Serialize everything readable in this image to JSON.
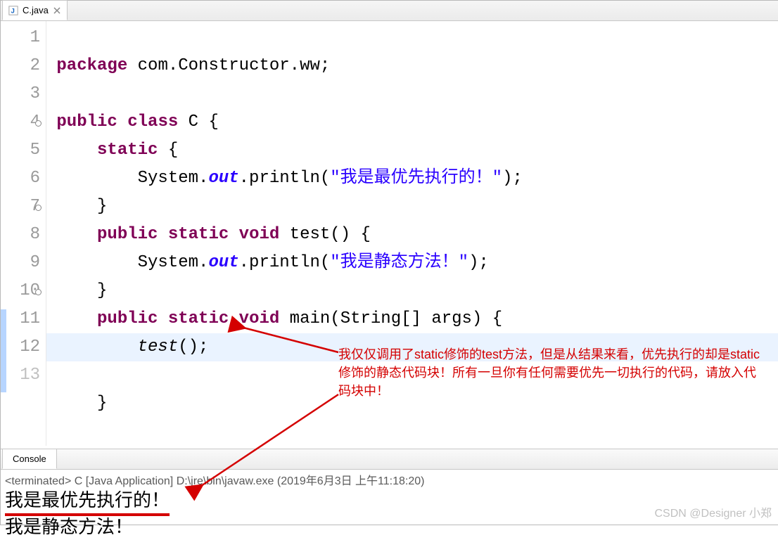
{
  "tab": {
    "filename": "C.java"
  },
  "code": {
    "lines": [
      "package com.Constructor.ww;",
      "",
      "public class C {",
      "    static {",
      "        System.out.println(\"我是最优先执行的！\");",
      "    }",
      "    public static void test() {",
      "        System.out.println(\"我是静态方法！\");",
      "    }",
      "    public static void main(String[] args) {",
      "        test();",
      "    }"
    ]
  },
  "console": {
    "tab_label": "Console",
    "status": "<terminated> C [Java Application] D:\\jre\\bin\\javaw.exe (2019年6月3日 上午11:18:20)",
    "output": [
      "我是最优先执行的！",
      "我是静态方法！"
    ]
  },
  "annotation": {
    "text": "我仅仅调用了static修饰的test方法，但是从结果来看，优先执行的却是static修饰的静态代码块！所有一旦你有任何需要优先一切执行的代码，请放入代码块中！"
  },
  "watermark": "CSDN @Designer 小郑"
}
